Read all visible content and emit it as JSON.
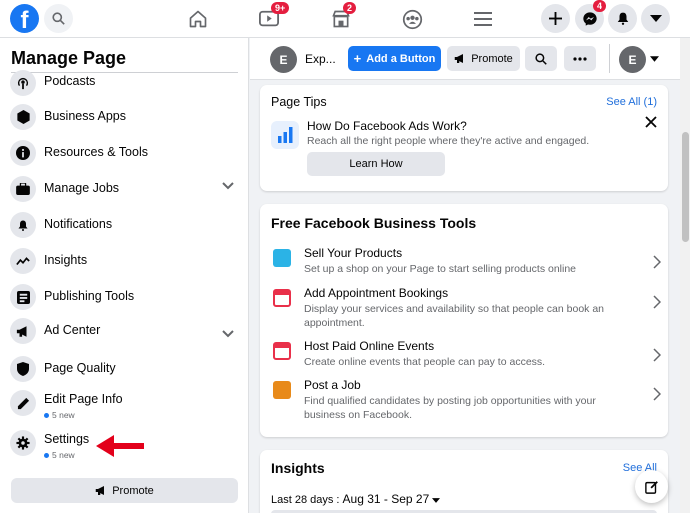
{
  "topbar": {
    "logo": "f",
    "watch_badge": "9+",
    "marketplace_badge": "2",
    "messenger_badge": "4"
  },
  "sidebar": {
    "title": "Manage Page",
    "items": [
      {
        "label": "Podcasts",
        "icon": "podcast-icon"
      },
      {
        "label": "Business Apps",
        "icon": "cube-icon"
      },
      {
        "label": "Resources & Tools",
        "icon": "info-icon"
      },
      {
        "label": "Manage Jobs",
        "icon": "briefcase-icon"
      },
      {
        "label": "Notifications",
        "icon": "bell-icon"
      },
      {
        "label": "Insights",
        "icon": "trend-icon"
      },
      {
        "label": "Publishing Tools",
        "icon": "tools-icon"
      },
      {
        "label": "Ad Center",
        "icon": "megaphone-icon"
      },
      {
        "label": "Page Quality",
        "icon": "shield-icon"
      },
      {
        "label": "Edit Page Info",
        "icon": "pencil-icon",
        "sub": "5 new"
      },
      {
        "label": "Settings",
        "icon": "gear-icon",
        "sub": "5 new"
      }
    ],
    "promote_label": "Promote"
  },
  "page_bar": {
    "avatar_letter": "E",
    "page_name": "Exp...",
    "add_button": "Add a Button",
    "promote": "Promote",
    "user_letter": "E"
  },
  "page_tips": {
    "title": "Page Tips",
    "see_all": "See All (1)",
    "tip_title": "How Do Facebook Ads Work?",
    "tip_desc": "Reach all the right people where they're active and engaged.",
    "learn_how": "Learn How"
  },
  "business_tools": {
    "title": "Free Facebook Business Tools",
    "tools": [
      {
        "title": "Sell Your Products",
        "desc": "Set up a shop on your Page to start selling products online",
        "color": "#2bb3e6"
      },
      {
        "title": "Add Appointment Bookings",
        "desc": "Display your services and availability so that people can book an appointment.",
        "color": "#e9304a"
      },
      {
        "title": "Host Paid Online Events",
        "desc": "Create online events that people can pay to access.",
        "color": "#e9304a"
      },
      {
        "title": "Post a Job",
        "desc": "Find qualified candidates by posting job opportunities with your business on Facebook.",
        "color": "#e88a1a"
      }
    ]
  },
  "insights": {
    "title": "Insights",
    "see_all": "See All",
    "range_label": "Last 28 days : ",
    "range_value": "Aug 31 - Sep 27"
  },
  "colors": {
    "brand": "#1877f2",
    "badge": "#e41e3f",
    "arrow": "#e3001b"
  }
}
